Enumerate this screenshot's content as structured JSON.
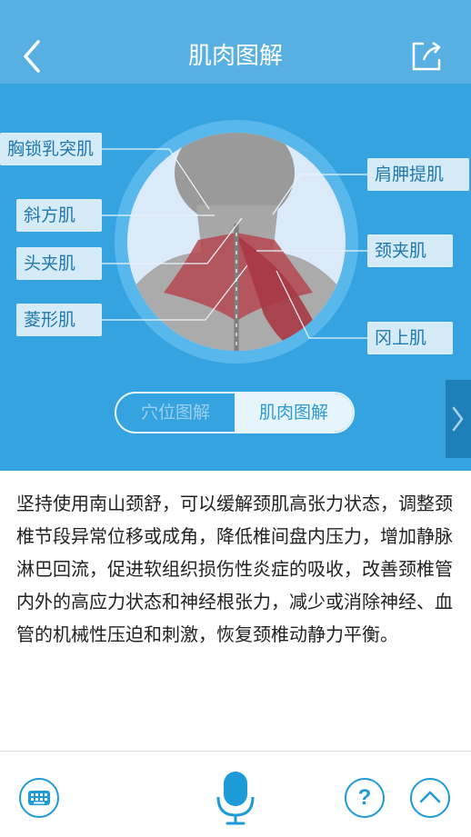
{
  "header": {
    "title": "肌肉图解"
  },
  "diagram": {
    "labels": {
      "l1": "胸锁乳突肌",
      "l2": "斜方肌",
      "l3": "头夹肌",
      "l4": "菱形肌",
      "r1": "肩胛提肌",
      "r2": "颈夹肌",
      "r3": "冈上肌"
    }
  },
  "toggle": {
    "acupoint": "穴位图解",
    "muscle": "肌肉图解",
    "selected": "muscle"
  },
  "description": "坚持使用南山颈舒，可以缓解颈肌高张力状态，调整颈椎节段异常位移或成角，降低椎间盘内压力，增加静脉淋巴回流，促进软组织损伤性炎症的吸收，改善颈椎管内外的高应力状态和神经根张力，减少或消除神经、血管的机械性压迫和刺激，恢复颈椎动静力平衡。",
  "bottom_bar": {
    "icons": [
      "keyboard-icon",
      "microphone-icon",
      "help-icon",
      "chevron-up-icon"
    ],
    "help_glyph": "?"
  },
  "colors": {
    "header": "#58b0e2",
    "diagram_bg": "#35a3df",
    "label_bg": "#d6ebf8",
    "label_text": "#2179ac",
    "accent": "#1c9bd7"
  }
}
